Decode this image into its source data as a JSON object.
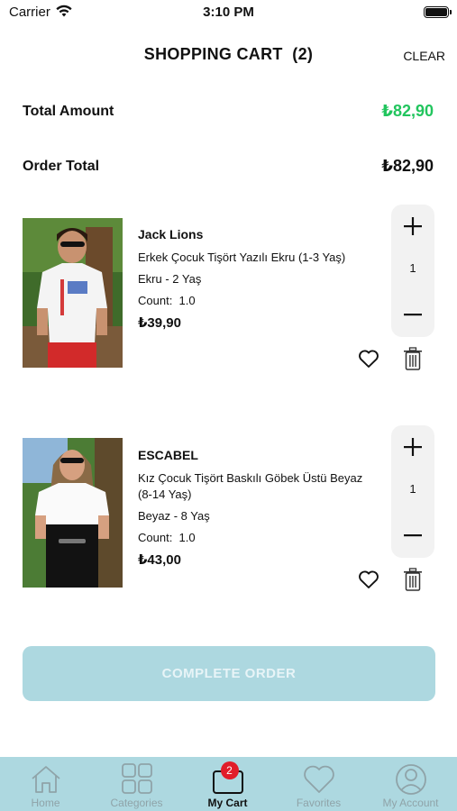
{
  "status_bar": {
    "carrier": "Carrier",
    "time": "3:10 PM"
  },
  "header": {
    "title": "SHOPPING CART  (2)",
    "clear_label": "CLEAR"
  },
  "summary": {
    "total_amount_label": "Total Amount",
    "total_amount_value": "₺82,90",
    "order_total_label": "Order Total",
    "order_total_value": "₺82,90"
  },
  "cart_items": [
    {
      "brand": "Jack Lions",
      "name": "Erkek Çocuk Tişört Yazılı Ekru (1-3 Yaş)",
      "variant": "Ekru - 2 Yaş",
      "count": "Count:  1.0",
      "price": "₺39,90",
      "quantity": "1"
    },
    {
      "brand": "ESCABEL",
      "name": "Kız Çocuk Tişört Baskılı Göbek Üstü Beyaz (8-14 Yaş)",
      "variant": "Beyaz - 8 Yaş",
      "count": "Count:  1.0",
      "price": "₺43,00",
      "quantity": "1"
    }
  ],
  "complete_order_label": "COMPLETE ORDER",
  "tabbar": {
    "tabs": [
      {
        "label": "Home",
        "icon": "home-icon"
      },
      {
        "label": "Categories",
        "icon": "categories-icon"
      },
      {
        "label": "My Cart",
        "icon": "cart-icon",
        "badge": "2",
        "active": true
      },
      {
        "label": "Favorites",
        "icon": "heart-icon"
      },
      {
        "label": "My Account",
        "icon": "account-icon"
      }
    ]
  },
  "colors": {
    "accent": "#add8e0",
    "price_green": "#22c55e",
    "badge_red": "#e11d2a"
  }
}
